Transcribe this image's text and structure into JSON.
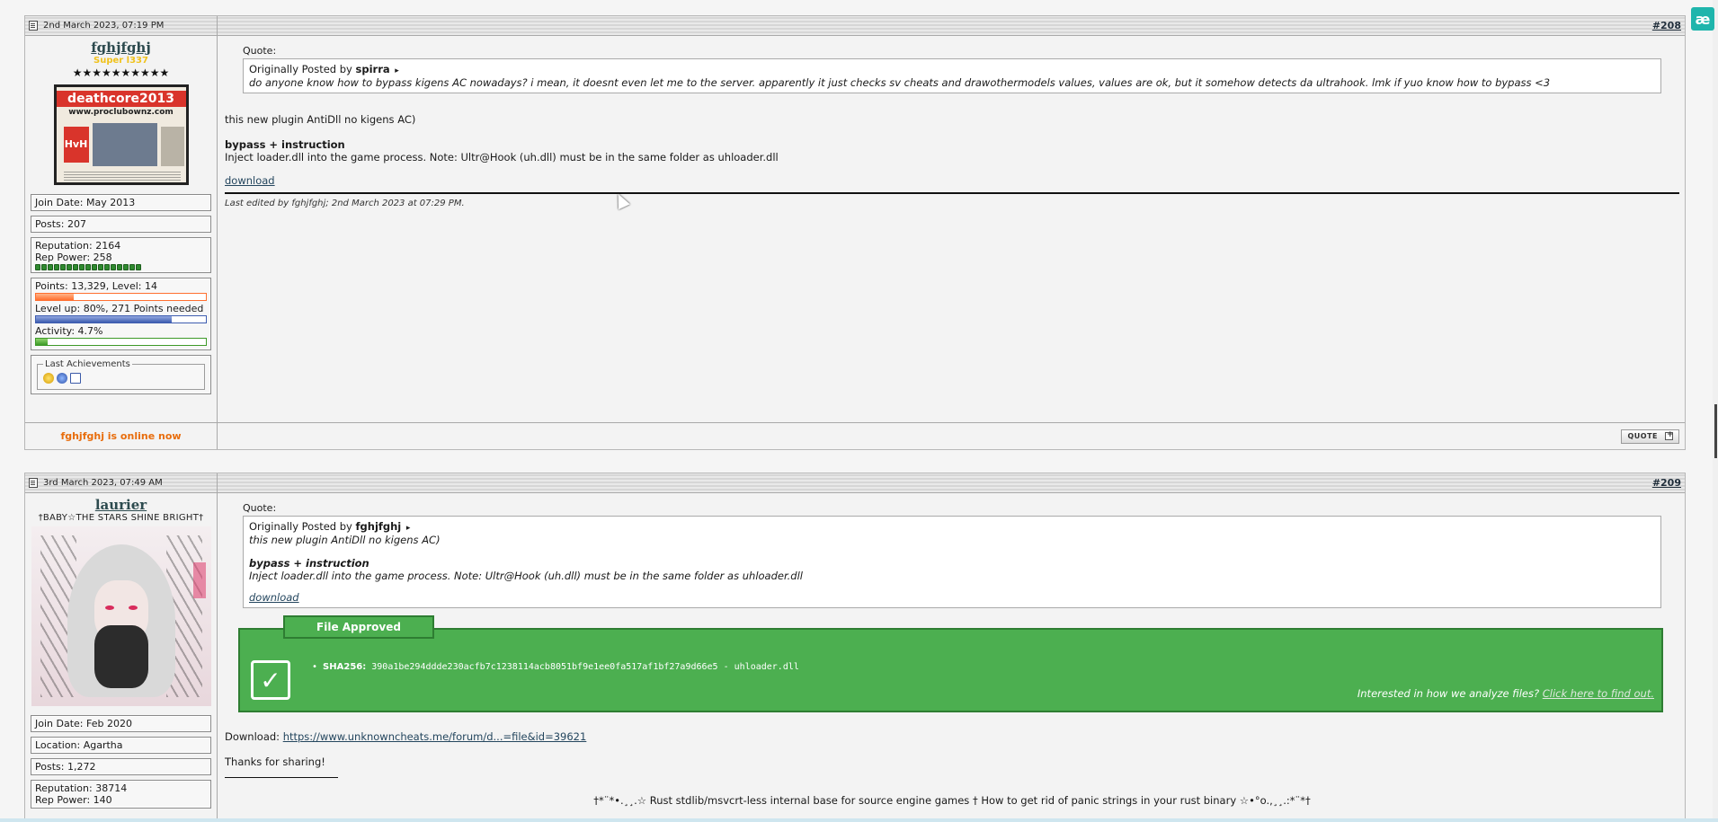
{
  "corner_badge": "æ",
  "posts": [
    {
      "date": "2nd March 2023, 07:19 PM",
      "number": "#208",
      "username": "fghjfghj",
      "usertitle": "Super l337",
      "stars": "★★★★★★★★★★",
      "avatar": {
        "band": "deathcore2013",
        "url": "www.proclubownz.com",
        "hvh": "HvH"
      },
      "join_date": "Join Date: May 2013",
      "posts": "Posts: 207",
      "reputation": "Reputation: 2164",
      "rep_power": "Rep Power: 258",
      "points": "Points: 13,329, Level: 14",
      "points_fill": 0.22,
      "levelup": "Level up: 80%, 271 Points needed",
      "levelup_fill": 0.8,
      "activity": "Activity: 4.7%",
      "activity_fill": 0.07,
      "achievements_label": "Last Achievements",
      "quote_label": "Quote:",
      "quote_byline_prefix": "Originally Posted by",
      "quote_author": "spirra",
      "quote_text": "do anyone know how to bypass kigens AC nowadays? i mean, it doesnt even let me to the server. apparently it just checks sv cheats and drawothermodels values, values are ok, but it somehow detects da ultrahook. lmk if yuo know how to bypass <3",
      "msg_line1": "this new plugin AntiDll no kigens AC)",
      "msg_bold": "bypass + instruction",
      "msg_line2": "Inject loader.dll into the game process. Note: Ultr@Hook (uh.dll) must be in the same folder as uhloader.dll",
      "msg_link": "download",
      "edit_note": "Last edited by fghjfghj; 2nd March 2023 at 07:29 PM.",
      "online_status": "fghjfghj is online now",
      "quote_button": "QUOTE"
    },
    {
      "date": "3rd March 2023, 07:49 AM",
      "number": "#209",
      "username": "laurier",
      "usertitle": "†BABY☆THE STARS SHINE BRIGHT†",
      "join_date": "Join Date: Feb 2020",
      "location": "Location: Agartha",
      "posts": "Posts: 1,272",
      "reputation": "Reputation: 38714",
      "rep_power": "Rep Power: 140",
      "quote_label": "Quote:",
      "quote_byline_prefix": "Originally Posted by",
      "quote_author": "fghjfghj",
      "quote_line1": "this new plugin AntiDll no kigens AC)",
      "quote_bold": "bypass + instruction",
      "quote_line2": "Inject loader.dll into the game process. Note: Ultr@Hook (uh.dll) must be in the same folder as uhloader.dll",
      "quote_link": "download",
      "approved_title": "File Approved",
      "sha_label": "SHA256:",
      "sha_value": "390a1be294ddde230acfb7c1238114acb8051bf9e1ee0fa517af1bf27a9d66e5 - uhloader.dll",
      "interested_text": "Interested in how we analyze files?",
      "interested_link": "Click here to find out.",
      "download_prefix": "Download:",
      "download_link": "https://www.unknowncheats.me/forum/d...=file&id=39621",
      "thanks": "Thanks for sharing!",
      "signature": "†*¨*•.¸¸.☆ Rust stdlib/msvcrt-less internal base for source engine games † How to get rid of panic strings in your rust binary ☆•°o.,¸¸.:*¨*†"
    }
  ]
}
